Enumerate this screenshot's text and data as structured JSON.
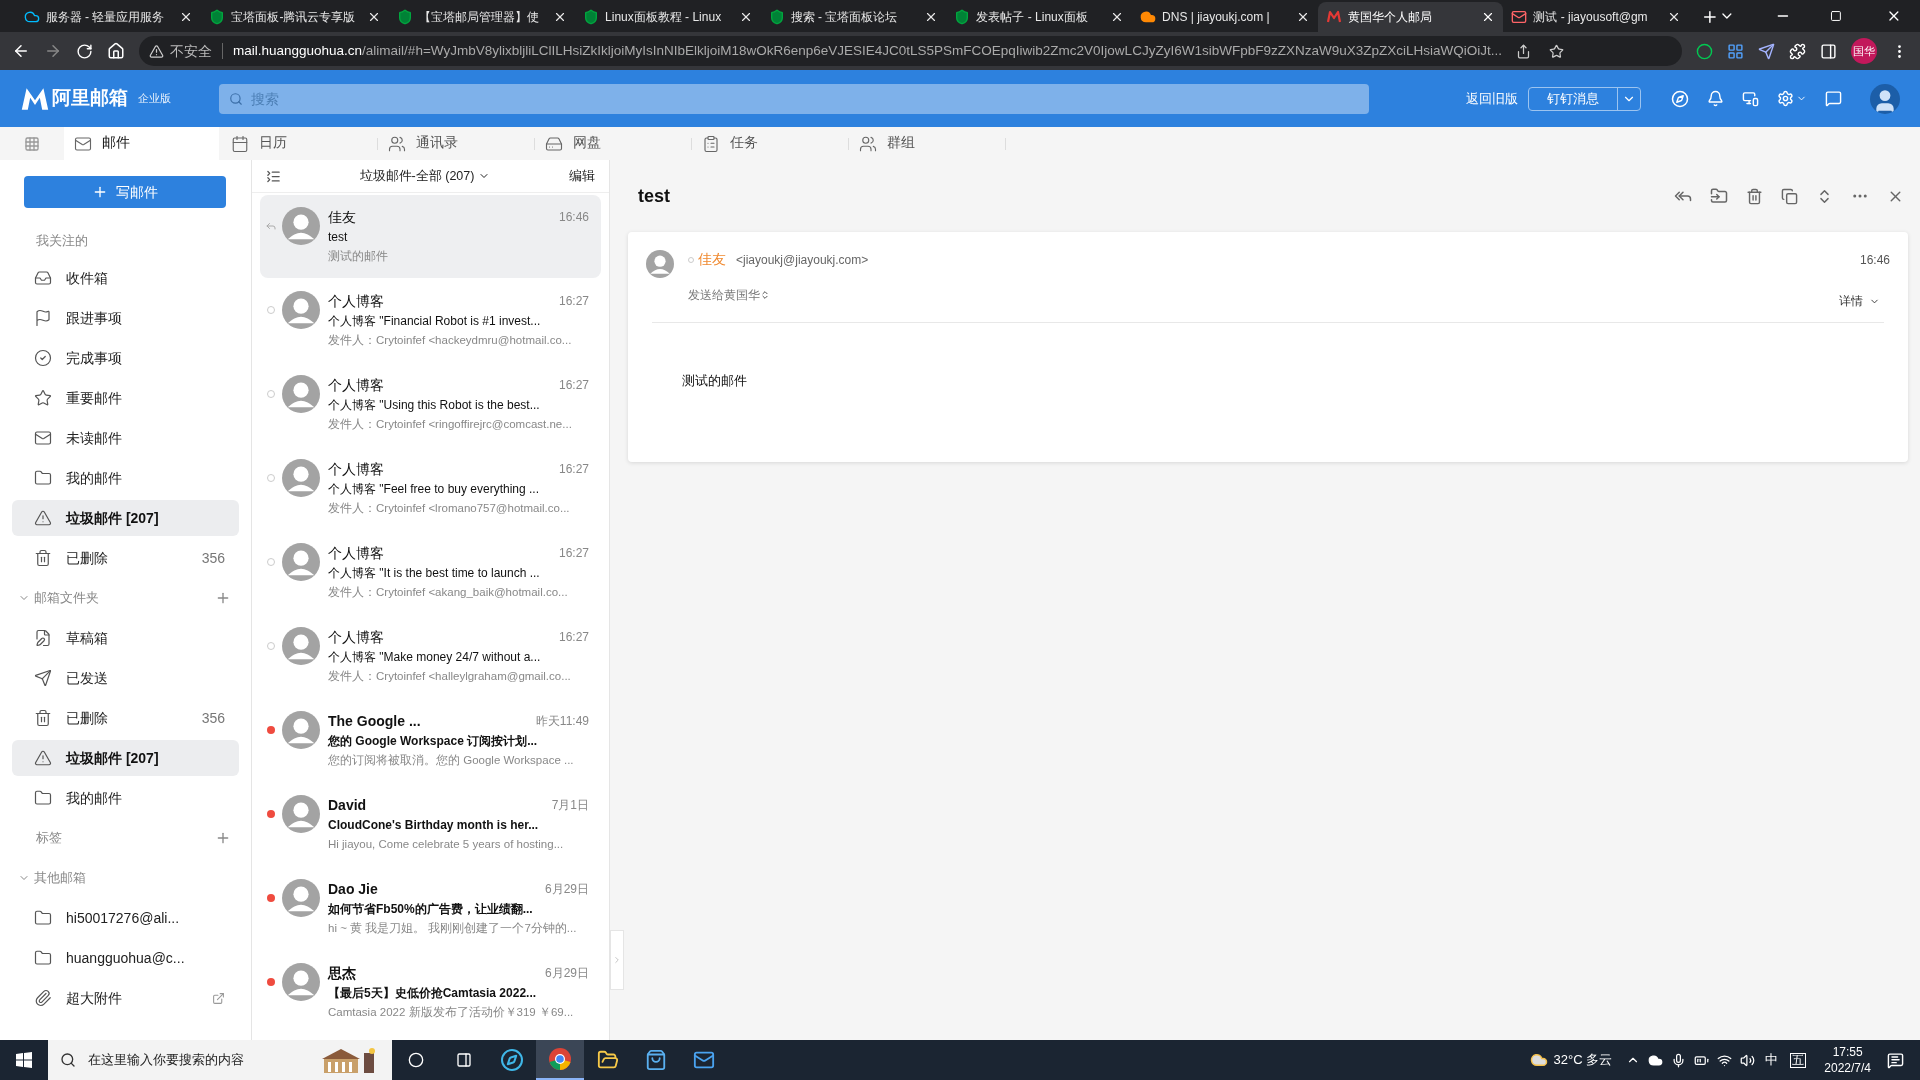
{
  "browser": {
    "tabs": [
      {
        "title": "服务器 - 轻量应用服务",
        "selected": false
      },
      {
        "title": "宝塔面板-腾讯云专享版",
        "selected": false
      },
      {
        "title": "【宝塔邮局管理器】使",
        "selected": false
      },
      {
        "title": "Linux面板教程 - Linux",
        "selected": false
      },
      {
        "title": "搜索 - 宝塔面板论坛",
        "selected": false
      },
      {
        "title": "发表帖子 - Linux面板",
        "selected": false
      },
      {
        "title": "DNS | jiayoukj.com |",
        "selected": false
      },
      {
        "title": "黄国华个人邮局",
        "selected": true
      },
      {
        "title": "测试 - jiayousoft@gm",
        "selected": false
      }
    ],
    "address": {
      "security": "不安全",
      "host": "mail.huangguohua.cn",
      "path": "/alimail/#h=WyJmbV8ylixbljliLClILHsiZkIkljoiMyIsInNIbElkljoiM18wOkR6enp6eVJESIE4JC0tLS5PSmFCOEpqIiwib2Zmc2V0IjowLCJyZyI6W1sibWFpbF9zZXNzaW9uX3ZpZXciLHsiaWQiOiJt..."
    },
    "profile": "国华"
  },
  "app": {
    "logo": {
      "name": "阿里邮箱",
      "edition": "企业版"
    },
    "search": {
      "placeholder": "搜索"
    },
    "old_version": "返回旧版",
    "dingtalk": "钉钉消息"
  },
  "nav": [
    {
      "label": "邮件",
      "selected": true
    },
    {
      "label": "日历",
      "selected": false
    },
    {
      "label": "通讯录",
      "selected": false
    },
    {
      "label": "网盘",
      "selected": false
    },
    {
      "label": "任务",
      "selected": false
    },
    {
      "label": "群组",
      "selected": false
    }
  ],
  "sidebar": {
    "compose": "写邮件",
    "items": [
      {
        "kind": "heading",
        "label": "我关注的"
      },
      {
        "kind": "folder",
        "label": "收件箱",
        "selected": false
      },
      {
        "kind": "folder",
        "label": "跟进事项",
        "selected": false
      },
      {
        "kind": "folder",
        "label": "完成事项",
        "selected": false
      },
      {
        "kind": "folder",
        "label": "重要邮件",
        "selected": false
      },
      {
        "kind": "folder",
        "label": "未读邮件",
        "selected": false
      },
      {
        "kind": "folder",
        "label": "我的邮件",
        "selected": false
      },
      {
        "kind": "folder",
        "label": "垃圾邮件 [207]",
        "selected": true
      },
      {
        "kind": "folder",
        "label": "已删除",
        "count": "356",
        "selected": false
      },
      {
        "kind": "heading",
        "label": "邮箱文件夹",
        "expanded": true,
        "addable": true
      },
      {
        "kind": "folder",
        "label": "草稿箱",
        "selected": false
      },
      {
        "kind": "folder",
        "label": "已发送",
        "selected": false
      },
      {
        "kind": "folder",
        "label": "已删除",
        "count": "356",
        "selected": false
      },
      {
        "kind": "folder",
        "label": "垃圾邮件 [207]",
        "selected": true
      },
      {
        "kind": "folder",
        "label": "我的邮件",
        "selected": false
      },
      {
        "kind": "heading",
        "label": "标签",
        "addable": true
      },
      {
        "kind": "heading",
        "label": "其他邮箱",
        "expanded": true
      },
      {
        "kind": "folder",
        "label": "hi50017276@ali...",
        "selected": false
      },
      {
        "kind": "folder",
        "label": "huangguohua@c...",
        "selected": false
      },
      {
        "kind": "folder",
        "label": "超大附件",
        "selected": false,
        "external": true
      }
    ]
  },
  "list": {
    "folder": "垃圾邮件-全部 (207)",
    "edit": "编辑",
    "messages": [
      {
        "sender": "佳友",
        "subject": "test",
        "preview": "测试的邮件",
        "time": "16:46",
        "kind": "replied",
        "selected": true
      },
      {
        "sender": "个人博客",
        "subject": "个人博客 \"Financial Robot is #1 invest...",
        "preview": "发件人：Crytoinfef <hackeydmru@hotmail.co...",
        "time": "16:27",
        "kind": "read",
        "selected": false
      },
      {
        "sender": "个人博客",
        "subject": "个人博客 \"Using this Robot is the best...",
        "preview": "发件人：Crytoinfef <ringoffirejrc@comcast.ne...",
        "time": "16:27",
        "kind": "read",
        "selected": false
      },
      {
        "sender": "个人博客",
        "subject": "个人博客 \"Feel free to buy everything ...",
        "preview": "发件人：Crytoinfef <lromano757@hotmail.co...",
        "time": "16:27",
        "kind": "read",
        "selected": false
      },
      {
        "sender": "个人博客",
        "subject": "个人博客 \"It is the best time to launch ...",
        "preview": "发件人：Crytoinfef <akang_baik@hotmail.co...",
        "time": "16:27",
        "kind": "read",
        "selected": false
      },
      {
        "sender": "个人博客",
        "subject": "个人博客 \"Make money 24/7 without a...",
        "preview": "发件人：Crytoinfef <halleylgraham@gmail.co...",
        "time": "16:27",
        "kind": "read",
        "selected": false
      },
      {
        "sender": "The Google ...",
        "subject": "您的 Google Workspace 订阅按计划...",
        "preview": "您的订阅将被取消。您的 Google Workspace ...",
        "time": "昨天11:49",
        "kind": "unread",
        "selected": false
      },
      {
        "sender": "David",
        "subject": "CloudCone's Birthday month is her...",
        "preview": "Hi jiayou,   Come celebrate 5 years of hosting...",
        "time": "7月1日",
        "kind": "unread",
        "selected": false
      },
      {
        "sender": "Dao Jie",
        "subject": "如何节省Fb50%的广告费，让业绩翻...",
        "preview": "hi ~ 黄 我是刀姐。 我刚刚创建了一个7分钟的...",
        "time": "6月29日",
        "kind": "unread",
        "selected": false
      },
      {
        "sender": "思杰",
        "subject": "【最后5天】史低价抢Camtasia 2022...",
        "preview": "Camtasia 2022 新版发布了活动价￥319 ￥69...",
        "time": "6月29日",
        "kind": "unread",
        "selected": false
      }
    ]
  },
  "reader": {
    "subject": "test",
    "sender_name": "佳友",
    "sender_email": "<jiayoukj@jiayoukj.com>",
    "time": "16:46",
    "recipients": "发送给黄国华",
    "details": "详情",
    "body": "测试的邮件"
  },
  "taskbar": {
    "search_placeholder": "在这里输入你要搜索的内容",
    "weather": "32°C 多云",
    "ime": "中",
    "ime_mode": "五",
    "time": "17:55",
    "date": "2022/7/4"
  }
}
